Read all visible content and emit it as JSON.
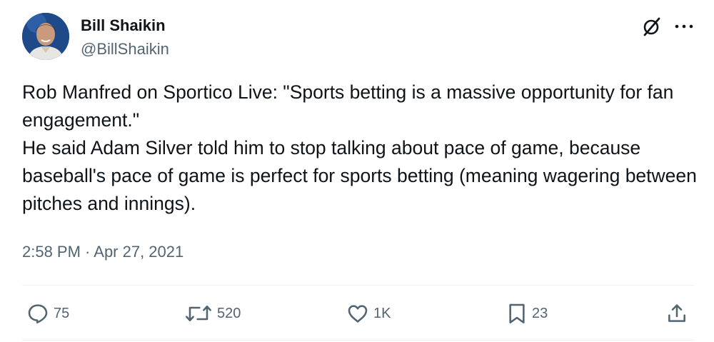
{
  "author": {
    "name": "Bill Shaikin",
    "handle": "@BillShaikin"
  },
  "icons": {
    "grok": "grok-icon",
    "more": "more-icon",
    "reply": "reply-icon",
    "retweet": "retweet-icon",
    "like": "heart-icon",
    "bookmark": "bookmark-icon",
    "share": "share-icon"
  },
  "tweet": {
    "paragraphs": [
      "Rob Manfred on Sportico Live: \"Sports betting is a massive opportunity for fan engagement.\"",
      "He said Adam Silver told him to stop talking about pace of game, because baseball's pace of game is perfect for sports betting (meaning wagering between pitches and innings)."
    ],
    "timestamp": "2:58 PM · Apr 27, 2021"
  },
  "metrics": {
    "replies": "75",
    "retweets": "520",
    "likes": "1K",
    "bookmarks": "23"
  },
  "colors": {
    "text": "#0f1419",
    "secondary": "#536471",
    "divider": "#eff3f4"
  }
}
